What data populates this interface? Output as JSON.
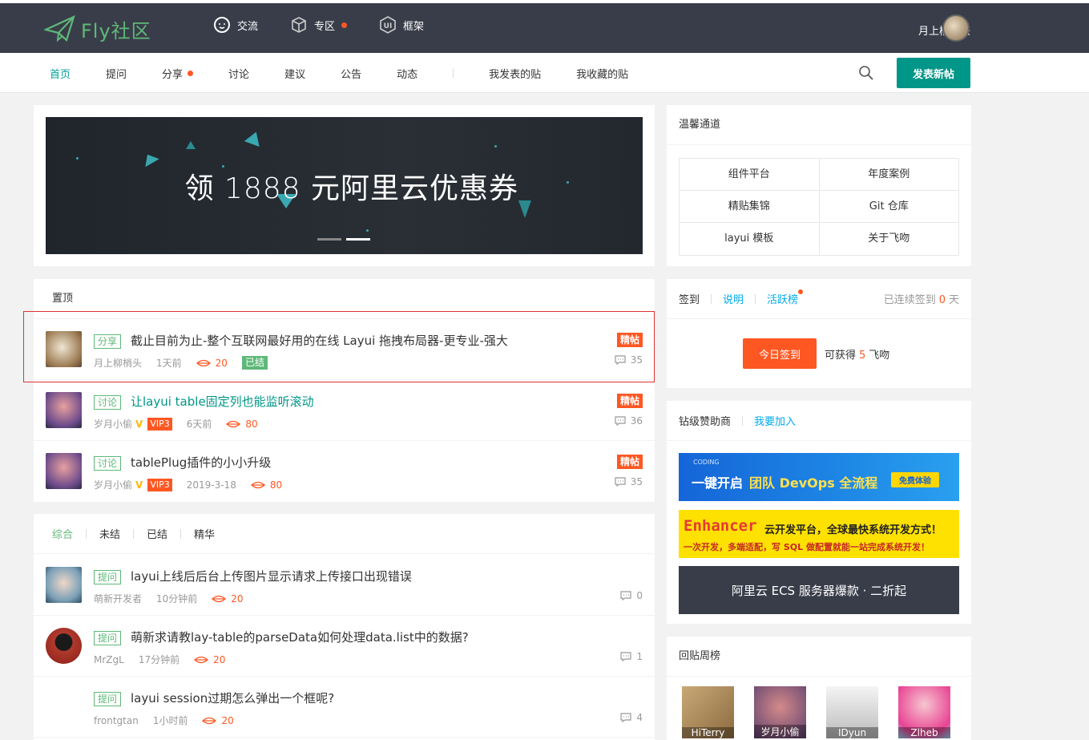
{
  "header": {
    "logo": "Fly社区",
    "nav": [
      {
        "label": "交流",
        "icon": "chat-icon"
      },
      {
        "label": "专区",
        "icon": "cube-icon",
        "dot": true
      },
      {
        "label": "框架",
        "icon": "ui-icon"
      }
    ],
    "user_name": "月上柳梢头"
  },
  "subnav": {
    "links": [
      "首页",
      "提问",
      "分享",
      "讨论",
      "建议",
      "公告",
      "动态"
    ],
    "my_links": [
      "我发表的贴",
      "我收藏的贴"
    ],
    "post_button": "发表新帖"
  },
  "banner": {
    "text": "领 1888 元阿里云优惠券"
  },
  "warm_channel": {
    "title": "温馨通道",
    "items": [
      "组件平台",
      "年度案例",
      "精贴集锦",
      "Git 仓库",
      "layui 模板",
      "关于飞吻"
    ]
  },
  "signin": {
    "tab": "签到",
    "explain": "说明",
    "active_rank": "活跃榜",
    "streak_prefix": "已连续签到",
    "streak_days": "0",
    "streak_suffix": "天",
    "button": "今日签到",
    "gain_prefix": "可获得",
    "gain_value": "5",
    "gain_suffix": "飞吻"
  },
  "sponsors": {
    "title": "钻级赞助商",
    "join": "我要加入",
    "ad1": {
      "brand": "CODING",
      "text1": "一键开启",
      "text2": "团队 DevOps 全流程",
      "btn": "免费体验"
    },
    "ad2": {
      "brand": "Enhancer",
      "line1": "云开发平台，全球最快系统开发方式！",
      "line2": "一次开发，多端适配，写 SQL 做配置就能一站完成系统开发！"
    },
    "ad3": {
      "text": "阿里云 ECS 服务器爆款 · 二折起"
    }
  },
  "weekly_rank": {
    "title": "回贴周榜",
    "users": [
      "HiTerry",
      "岁月小偷",
      "IDyun",
      "Zlheb"
    ]
  },
  "top_posts": {
    "title": "置顶",
    "items": [
      {
        "tag": "分享",
        "title": "截止目前为止-整个互联网最好用的在线 Layui 拖拽布局器-更专业-强大",
        "author": "月上柳梢头",
        "time": "1天前",
        "hot": "20",
        "status": "已结",
        "badge": "精帖",
        "comments": "35"
      },
      {
        "tag": "讨论",
        "title": "让layui table固定列也能监听滚动",
        "author": "岁月小偷",
        "vip": "VIP3",
        "time": "6天前",
        "hot": "80",
        "badge": "精帖",
        "comments": "36"
      },
      {
        "tag": "讨论",
        "title": "tablePlug插件的小小升级",
        "author": "岁月小偷",
        "vip": "VIP3",
        "time": "2019-3-18",
        "hot": "80",
        "badge": "精帖",
        "comments": "35"
      }
    ]
  },
  "list": {
    "tabs": [
      "综合",
      "未结",
      "已结",
      "精华"
    ],
    "items": [
      {
        "tag": "提问",
        "title": "layui上线后后台上传图片显示请求上传接口出现错误",
        "author": "萌新开发者",
        "time": "10分钟前",
        "hot": "20",
        "comments": "0"
      },
      {
        "tag": "提问",
        "title": "萌新求请教lay-table的parseData如何处理data.list中的数据?",
        "author": "MrZgL",
        "time": "17分钟前",
        "hot": "20",
        "comments": "1"
      },
      {
        "tag": "提问",
        "title": "layui session过期怎么弹出一个框呢?",
        "author": "frontgtan",
        "time": "1小时前",
        "hot": "20",
        "comments": "4"
      }
    ]
  },
  "colors": {
    "accent": "#009688",
    "green": "#5fb878",
    "orange": "#ff5722",
    "header": "#393d49"
  }
}
